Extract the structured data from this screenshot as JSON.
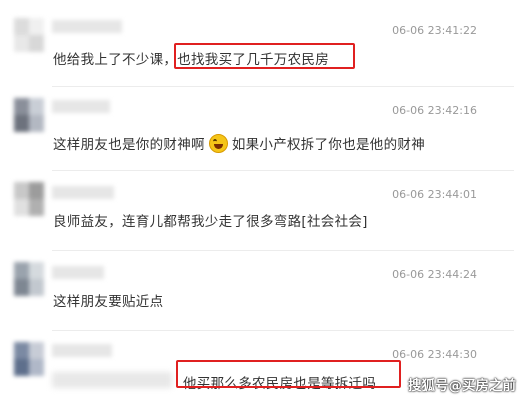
{
  "comments": [
    {
      "time": "06-06 23:41:22",
      "text_part1": "他给我上了不少课，",
      "text_part2": "也找我买了几千万农民房",
      "avatar_colors": [
        "#dcdcdc",
        "#f0f0f0",
        "#e8e8e8",
        "#d8d8d8"
      ]
    },
    {
      "time": "06-06 23:42:16",
      "text_part1": "这样朋友也是你的财神啊",
      "emoji": "laughing-crying-face",
      "text_part2": "如果小产权拆了你也是他的财神",
      "avatar_colors": [
        "#8a8f9a",
        "#c9ced6",
        "#6d727d",
        "#b3b8c2"
      ]
    },
    {
      "time": "06-06 23:44:01",
      "text": "良师益友，连育儿都帮我少走了很多弯路[社会社会]",
      "avatar_colors": [
        "#c8c8c8",
        "#9c9c9c",
        "#e0e0e0",
        "#b0b0b0"
      ]
    },
    {
      "time": "06-06 23:44:24",
      "text": "这样朋友要贴近点",
      "avatar_colors": [
        "#9aa3ad",
        "#d5dade",
        "#7e8792",
        "#c2c8cf"
      ]
    },
    {
      "time": "06-06 23:44:30",
      "text": "他买那么多农民房也是等拆迁吗",
      "avatar_colors": [
        "#7b8aa3",
        "#c7ccd6",
        "#5e6f8c",
        "#b0b8c8"
      ]
    }
  ],
  "watermark": "搜狐号@买房之前",
  "colors": {
    "highlight": "#e02020",
    "time": "#999999",
    "text": "#333333"
  }
}
